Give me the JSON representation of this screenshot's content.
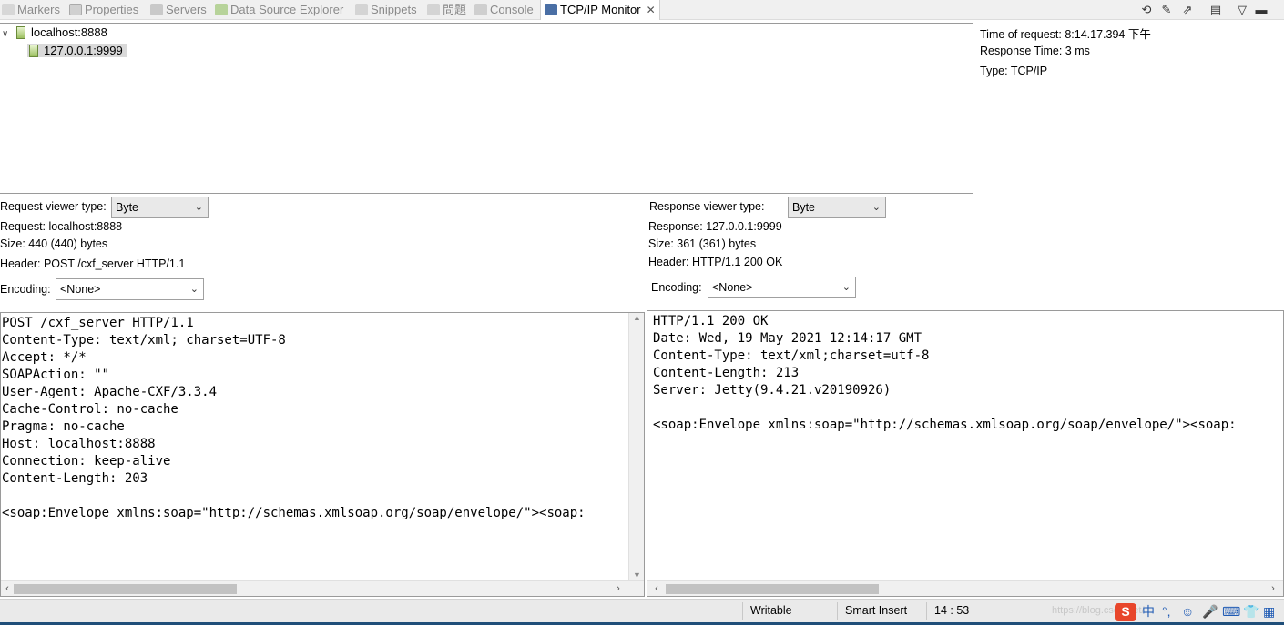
{
  "tabs": [
    {
      "label": "Markers",
      "icon": "markers-icon"
    },
    {
      "label": "Properties",
      "icon": "properties-icon"
    },
    {
      "label": "Servers",
      "icon": "servers-icon"
    },
    {
      "label": "Data Source Explorer",
      "icon": "data-source-icon"
    },
    {
      "label": "Snippets",
      "icon": "snippets-icon"
    },
    {
      "label": "問題",
      "icon": "problems-icon"
    },
    {
      "label": "Console",
      "icon": "console-icon"
    },
    {
      "label": "TCP/IP Monitor",
      "icon": "tcpip-monitor-icon",
      "active": true
    }
  ],
  "close_glyph": "✕",
  "tree": {
    "root": "localhost:8888",
    "child": "127.0.0.1:9999"
  },
  "details": {
    "time_of_request": "Time of request: 8:14.17.394 下午",
    "response_time": "Response Time: 3 ms",
    "type": "Type: TCP/IP"
  },
  "request": {
    "viewer_type_label": "Request viewer type:",
    "viewer_type_value": "Byte",
    "request_line": "Request: localhost:8888",
    "size": "Size: 440 (440) bytes",
    "header": "Header: POST /cxf_server HTTP/1.1",
    "encoding_label": "Encoding:",
    "encoding_value": "<None>",
    "body": "POST /cxf_server HTTP/1.1\nContent-Type: text/xml; charset=UTF-8\nAccept: */*\nSOAPAction: \"\"\nUser-Agent: Apache-CXF/3.3.4\nCache-Control: no-cache\nPragma: no-cache\nHost: localhost:8888\nConnection: keep-alive\nContent-Length: 203\n\n<soap:Envelope xmlns:soap=\"http://schemas.xmlsoap.org/soap/envelope/\"><soap:"
  },
  "response": {
    "viewer_type_label": "Response viewer type:",
    "viewer_type_value": "Byte",
    "response_line": "Response: 127.0.0.1:9999",
    "size": "Size: 361 (361) bytes",
    "header": "Header: HTTP/1.1 200 OK",
    "encoding_label": "Encoding:",
    "encoding_value": "<None>",
    "body": "HTTP/1.1 200 OK\nDate: Wed, 19 May 2021 12:14:17 GMT\nContent-Type: text/xml;charset=utf-8\nContent-Length: 213\nServer: Jetty(9.4.21.v20190926)\n\n<soap:Envelope xmlns:soap=\"http://schemas.xmlsoap.org/soap/envelope/\"><soap:"
  },
  "status": {
    "writable": "Writable",
    "insert_mode": "Smart Insert",
    "position": "14 : 53",
    "ime_lang": "中",
    "watermark": "https://blog.csdn.net/..."
  }
}
